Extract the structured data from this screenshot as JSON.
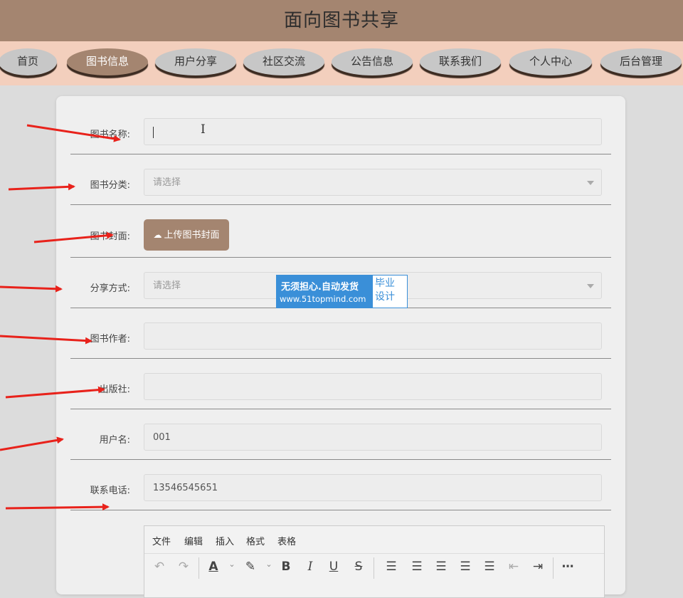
{
  "header": {
    "title": "面向图书共享"
  },
  "nav": {
    "items": [
      "首页",
      "图书信息",
      "用户分享",
      "社区交流",
      "公告信息",
      "联系我们",
      "个人中心",
      "后台管理"
    ],
    "active_index": 1
  },
  "form": {
    "fields": [
      {
        "label": "图书名称:",
        "type": "text",
        "value": "",
        "placeholder": ""
      },
      {
        "label": "图书分类:",
        "type": "select",
        "value": "请选择"
      },
      {
        "label": "图书封面:",
        "type": "upload",
        "button": "上传图书封面"
      },
      {
        "label": "分享方式:",
        "type": "select",
        "value": "请选择"
      },
      {
        "label": "图书作者:",
        "type": "text",
        "value": ""
      },
      {
        "label": "出版社:",
        "type": "text",
        "value": ""
      },
      {
        "label": "用户名:",
        "type": "text",
        "value": "001"
      },
      {
        "label": "联系电话:",
        "type": "text",
        "value": "13546545651"
      }
    ]
  },
  "editor": {
    "menu": [
      "文件",
      "编辑",
      "插入",
      "格式",
      "表格"
    ],
    "toolbar_icons": [
      "undo-icon",
      "redo-icon",
      "text-color-icon",
      "highlight-icon",
      "bold-icon",
      "italic-icon",
      "underline-icon",
      "strikethrough-icon",
      "line-height-icon",
      "align-left-icon",
      "align-center-icon",
      "align-right-icon",
      "align-justify-icon",
      "outdent-icon",
      "indent-icon",
      "more-icon"
    ]
  },
  "watermark": {
    "line1": "无须担心.自动发货",
    "line2": "www.51topmind.com",
    "side1": "毕业",
    "side2": "设计"
  },
  "colors": {
    "header": "#a48570",
    "navbar": "#f3cfbd",
    "nav_pill": "#c7c7c7",
    "active": "#a48570",
    "arrow": "#e8221b",
    "watermark": "#3a8fd8"
  }
}
